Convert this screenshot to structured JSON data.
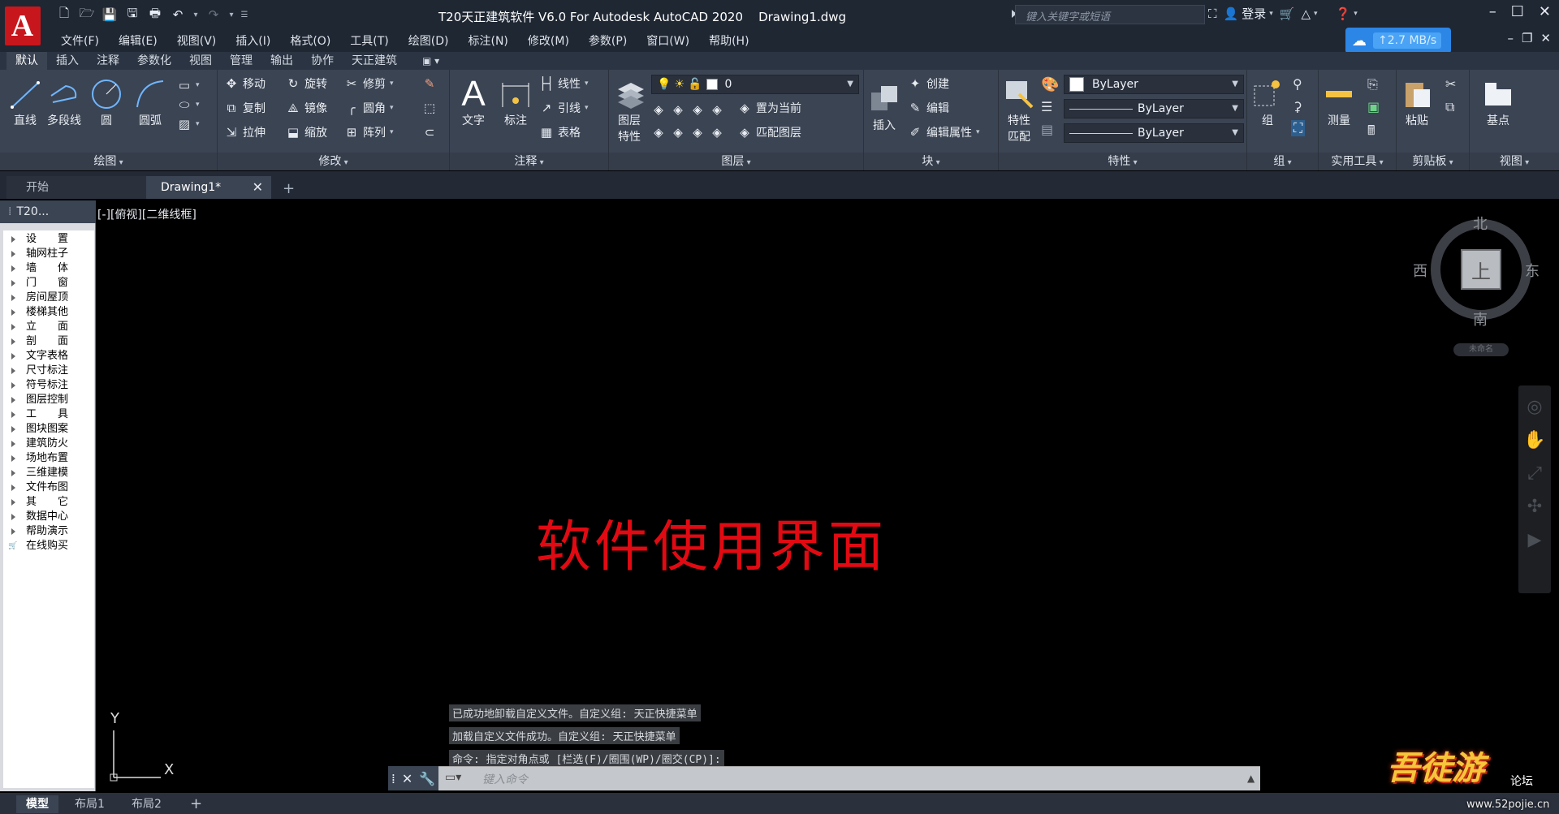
{
  "app": {
    "logo_letter": "A",
    "title": "T20天正建筑软件 V6.0 For Autodesk AutoCAD 2020    Drawing1.dwg",
    "search_placeholder": "键入关键字或短语",
    "login": "登录",
    "net_speed": "↑2.7 MB/s"
  },
  "menu": [
    "文件(F)",
    "编辑(E)",
    "视图(V)",
    "插入(I)",
    "格式(O)",
    "工具(T)",
    "绘图(D)",
    "标注(N)",
    "修改(M)",
    "参数(P)",
    "窗口(W)",
    "帮助(H)"
  ],
  "ribbon_tabs": [
    "默认",
    "插入",
    "注释",
    "参数化",
    "视图",
    "管理",
    "输出",
    "协作",
    "天正建筑"
  ],
  "ribbon": {
    "draw": {
      "title": "绘图",
      "line": "直线",
      "polyline": "多段线",
      "circle": "圆",
      "arc": "圆弧"
    },
    "modify": {
      "title": "修改",
      "move": "移动",
      "rotate": "旋转",
      "trim": "修剪",
      "copy": "复制",
      "mirror": "镜像",
      "fillet": "圆角",
      "stretch": "拉伸",
      "scale": "缩放",
      "array": "阵列"
    },
    "annotation": {
      "title": "注释",
      "text": "文字",
      "dimension": "标注",
      "linear": "线性",
      "leader": "引线",
      "table": "表格"
    },
    "layers": {
      "title": "图层",
      "layer_props": "图层\n特性",
      "layer_props_line1": "图层",
      "layer_props_line2": "特性",
      "current_layer": "0",
      "set_current": "置为当前",
      "match_layer": "匹配图层"
    },
    "block": {
      "title": "块",
      "insert": "插入",
      "create": "创建",
      "edit": "编辑",
      "edit_attr": "编辑属性"
    },
    "properties": {
      "title": "特性",
      "match_line1": "特性",
      "match_line2": "匹配",
      "color": "ByLayer",
      "linetype": "ByLayer",
      "lineweight": "ByLayer"
    },
    "groups": {
      "title": "组",
      "group": "组"
    },
    "utilities": {
      "title": "实用工具",
      "measure": "测量"
    },
    "clipboard": {
      "title": "剪贴板",
      "paste": "粘贴"
    },
    "view": {
      "title": "视图",
      "base": "基点"
    }
  },
  "file_tabs": {
    "start": "开始",
    "drawing": "Drawing1*"
  },
  "palette": {
    "title": "T20...",
    "items": [
      "设　　置",
      "轴网柱子",
      "墙　　体",
      "门　　窗",
      "房间屋顶",
      "楼梯其他",
      "立　　面",
      "剖　　面",
      "文字表格",
      "尺寸标注",
      "符号标注",
      "图层控制",
      "工　　具",
      "图块图案",
      "建筑防火",
      "场地布置",
      "三维建模",
      "文件布图",
      "其　　它",
      "数据中心",
      "帮助演示"
    ],
    "shop_item": "在线购买"
  },
  "viewport": {
    "label": "[-][俯视][二维线框]",
    "big_text": "软件使用界面",
    "ucs_x": "X",
    "ucs_y": "Y"
  },
  "viewcube": {
    "north": "北",
    "south": "南",
    "east": "东",
    "west": "西",
    "top": "上",
    "unnamed": "未命名"
  },
  "command": {
    "history": [
      "已成功地卸载自定义文件。自定义组: 天正快捷菜单",
      "加载自定义文件成功。自定义组: 天正快捷菜单",
      "命令: 指定对角点或 [栏选(F)/圈围(WP)/圈交(CP)]:"
    ],
    "placeholder": "键入命令"
  },
  "layout_tabs": [
    "模型",
    "布局1",
    "布局2"
  ],
  "watermark": {
    "logo": "吾徒游",
    "forum": "论坛",
    "url": "www.52pojie.cn"
  },
  "colors": {
    "accent_red": "#e10a12",
    "ribbon_bg": "#3b4453",
    "title_bg": "#1f2733"
  }
}
